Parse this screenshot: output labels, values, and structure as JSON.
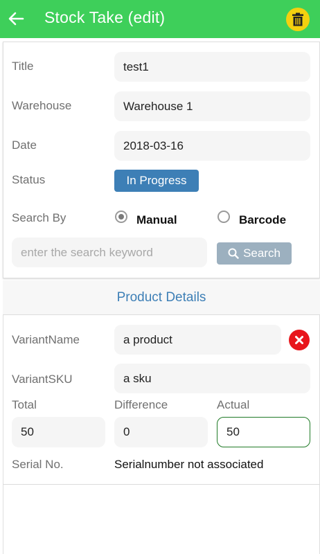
{
  "appbar": {
    "title": "Stock Take (edit)",
    "back_icon": "arrow-left-icon",
    "delete_icon": "trash-icon",
    "colors": {
      "background": "#3ecf5a",
      "delete_button": "#f4d00f"
    }
  },
  "form": {
    "title_label": "Title",
    "title_value": "test1",
    "warehouse_label": "Warehouse",
    "warehouse_value": "Warehouse 1",
    "date_label": "Date",
    "date_value": "2018-03-16",
    "status_label": "Status",
    "status_value": "In Progress",
    "search_by_label": "Search By",
    "search_by_options": [
      {
        "label": "Manual",
        "selected": true
      },
      {
        "label": "Barcode",
        "selected": false
      }
    ],
    "search_placeholder": "enter the search keyword",
    "search_value": "",
    "search_button_label": "Search",
    "colors": {
      "status": "#3d7fb6",
      "search_button": "#9cb0bf"
    }
  },
  "product_details": {
    "header": "Product Details",
    "variant_name_label": "VariantName",
    "variant_name_value": "a product",
    "variant_sku_label": "VariantSKU",
    "variant_sku_value": "a sku",
    "total_label": "Total",
    "total_value": "50",
    "difference_label": "Difference",
    "difference_value": "0",
    "actual_label": "Actual",
    "actual_value": "50",
    "serial_label": "Serial No.",
    "serial_value": "Serialnumber not associated",
    "remove_icon": "close-circle-icon",
    "colors": {
      "header_text": "#3d7fb6",
      "remove_button": "#e8161c",
      "active_border": "#1f7a26"
    }
  }
}
